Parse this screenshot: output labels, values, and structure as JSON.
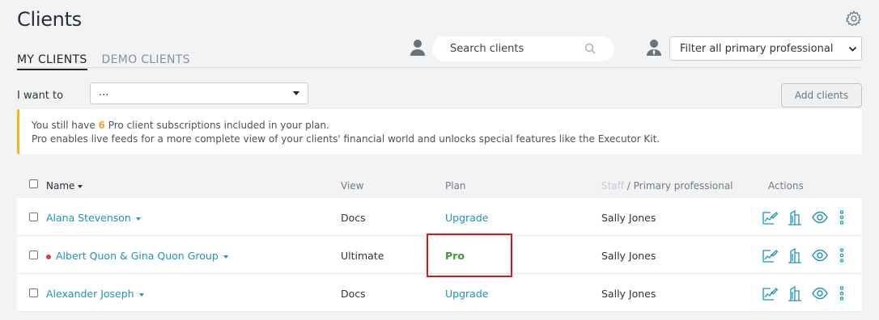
{
  "page": {
    "title": "Clients"
  },
  "tabs": [
    {
      "label": "MY CLIENTS",
      "active": true
    },
    {
      "label": "DEMO CLIENTS",
      "active": false
    }
  ],
  "search": {
    "placeholder": "Search clients"
  },
  "filter": {
    "selected": "Filter all primary professional"
  },
  "i_want": {
    "label": "I want to",
    "value": "..."
  },
  "add_clients": {
    "label": "Add clients"
  },
  "banner": {
    "line1_pre": "You still have",
    "count": "6",
    "line1_post": "Pro client subscriptions included in your plan.",
    "line2": "Pro enables live feeds for a more complete view of your clients' financial world and unlocks special features like the Executor Kit.",
    "accent": "#f5b21b"
  },
  "table": {
    "headers": {
      "name": "Name",
      "view": "View",
      "plan": "Plan",
      "staff": "Staff",
      "staff_sep": " / ",
      "primary": "Primary professional",
      "actions": "Actions"
    },
    "rows": [
      {
        "name": "Alana Stevenson",
        "view": "Docs",
        "plan": "Upgrade",
        "professional": "Sally Jones",
        "flag": false
      },
      {
        "name": "Albert Quon & Gina Quon Group",
        "view": "Ultimate",
        "plan": "Pro",
        "professional": "Sally Jones",
        "flag": true
      },
      {
        "name": "Alexander Joseph",
        "view": "Docs",
        "plan": "Upgrade",
        "professional": "Sally Jones",
        "flag": false
      }
    ]
  },
  "colors": {
    "link": "#1f94b6",
    "pro": "#3d9a2b",
    "highlight": "#d9171e"
  },
  "icons": [
    "gear-icon",
    "person-icon",
    "search-icon",
    "chevron-down-icon",
    "edit-chart-icon",
    "building-icon",
    "eye-icon",
    "more-vertical-icon"
  ]
}
